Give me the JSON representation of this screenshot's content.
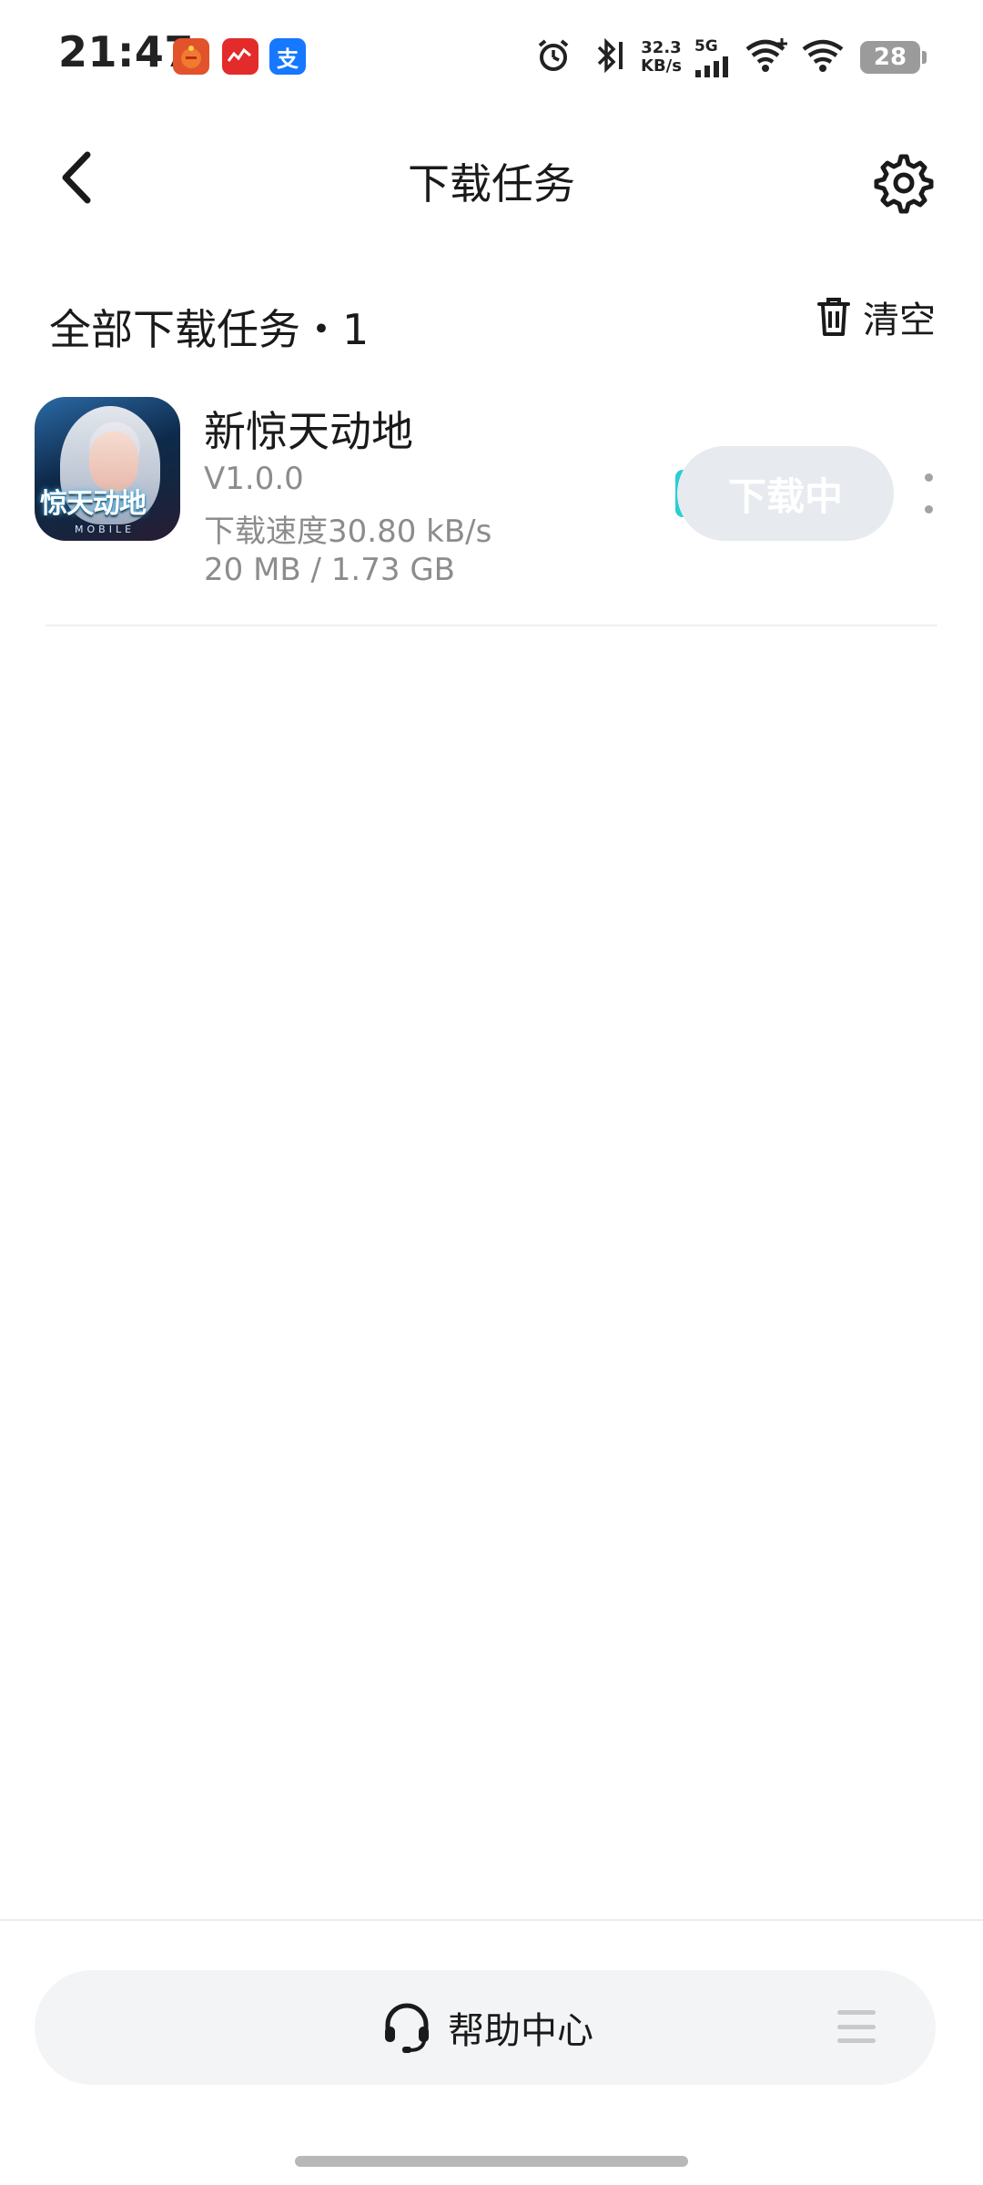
{
  "status_bar": {
    "time": "21:47",
    "notification_icons": [
      "game-app-icon",
      "news-app-icon",
      "alipay-icon"
    ],
    "alipay_glyph": "支",
    "net_speed_value": "32.3",
    "net_speed_unit": "KB/s",
    "network_type": "5G",
    "battery_level": "28"
  },
  "header": {
    "title": "下载任务"
  },
  "section": {
    "title": "全部下载任务・1",
    "clear_label": "清空"
  },
  "downloads": [
    {
      "name": "新惊天动地",
      "icon_logo_text": "惊天动地",
      "icon_sub_text": "MOBILE",
      "version": "V1.0.0",
      "speed": "下载速度30.80 kB/s",
      "progress": "20 MB / 1.73 GB",
      "button_label": "下载中"
    }
  ],
  "bottom": {
    "help_label": "帮助中心"
  },
  "colors": {
    "button_bg": "#e7eaee",
    "progress_accent": "#27cfd2",
    "meta_text": "#8c8c8c"
  }
}
